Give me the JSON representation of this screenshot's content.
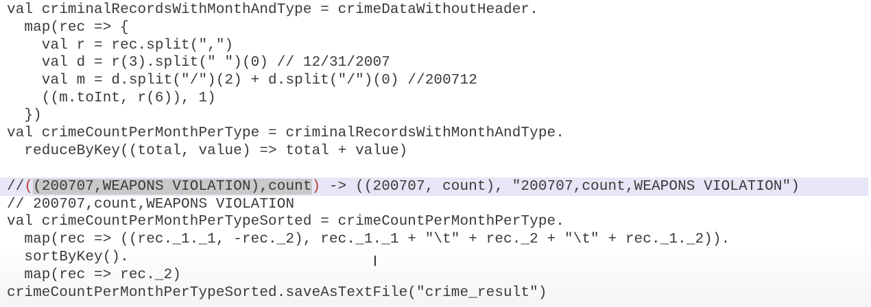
{
  "editor": {
    "lines": [
      "val criminalRecordsWithMonthAndType = crimeDataWithoutHeader.",
      "  map(rec => {",
      "    val r = rec.split(\",\")",
      "    val d = r(3).split(\" \")(0) // 12/31/2007",
      "    val m = d.split(\"/\")(2) + d.split(\"/\")(0) //200712",
      "    ((m.toInt, r(6)), 1)",
      "  })",
      "val crimeCountPerMonthPerType = criminalRecordsWithMonthAndType.",
      "  reduceByKey((total, value) => total + value)",
      "",
      "",
      "// 200707,count,WEAPONS VIOLATION",
      "val crimeCountPerMonthPerTypeSorted = crimeCountPerMonthPerType.",
      "  map(rec => ((rec._1._1, -rec._2), rec._1._1 + \"\\t\" + rec._2 + \"\\t\" + rec._1._2)).",
      "  sortByKey().",
      "  map(rec => rec._2)",
      "crimeCountPerMonthPerTypeSorted.saveAsTextFile(\"crime_result\")"
    ],
    "highlighted_line": {
      "comment_prefix": "//",
      "open_paren": "(",
      "selected_text": "(200707,WEAPONS VIOLATION),count",
      "close_paren": ")",
      "rest": " -> ((200707, count), \"200707,count,WEAPONS VIOLATION\")"
    },
    "cursor_glyph": "I"
  }
}
